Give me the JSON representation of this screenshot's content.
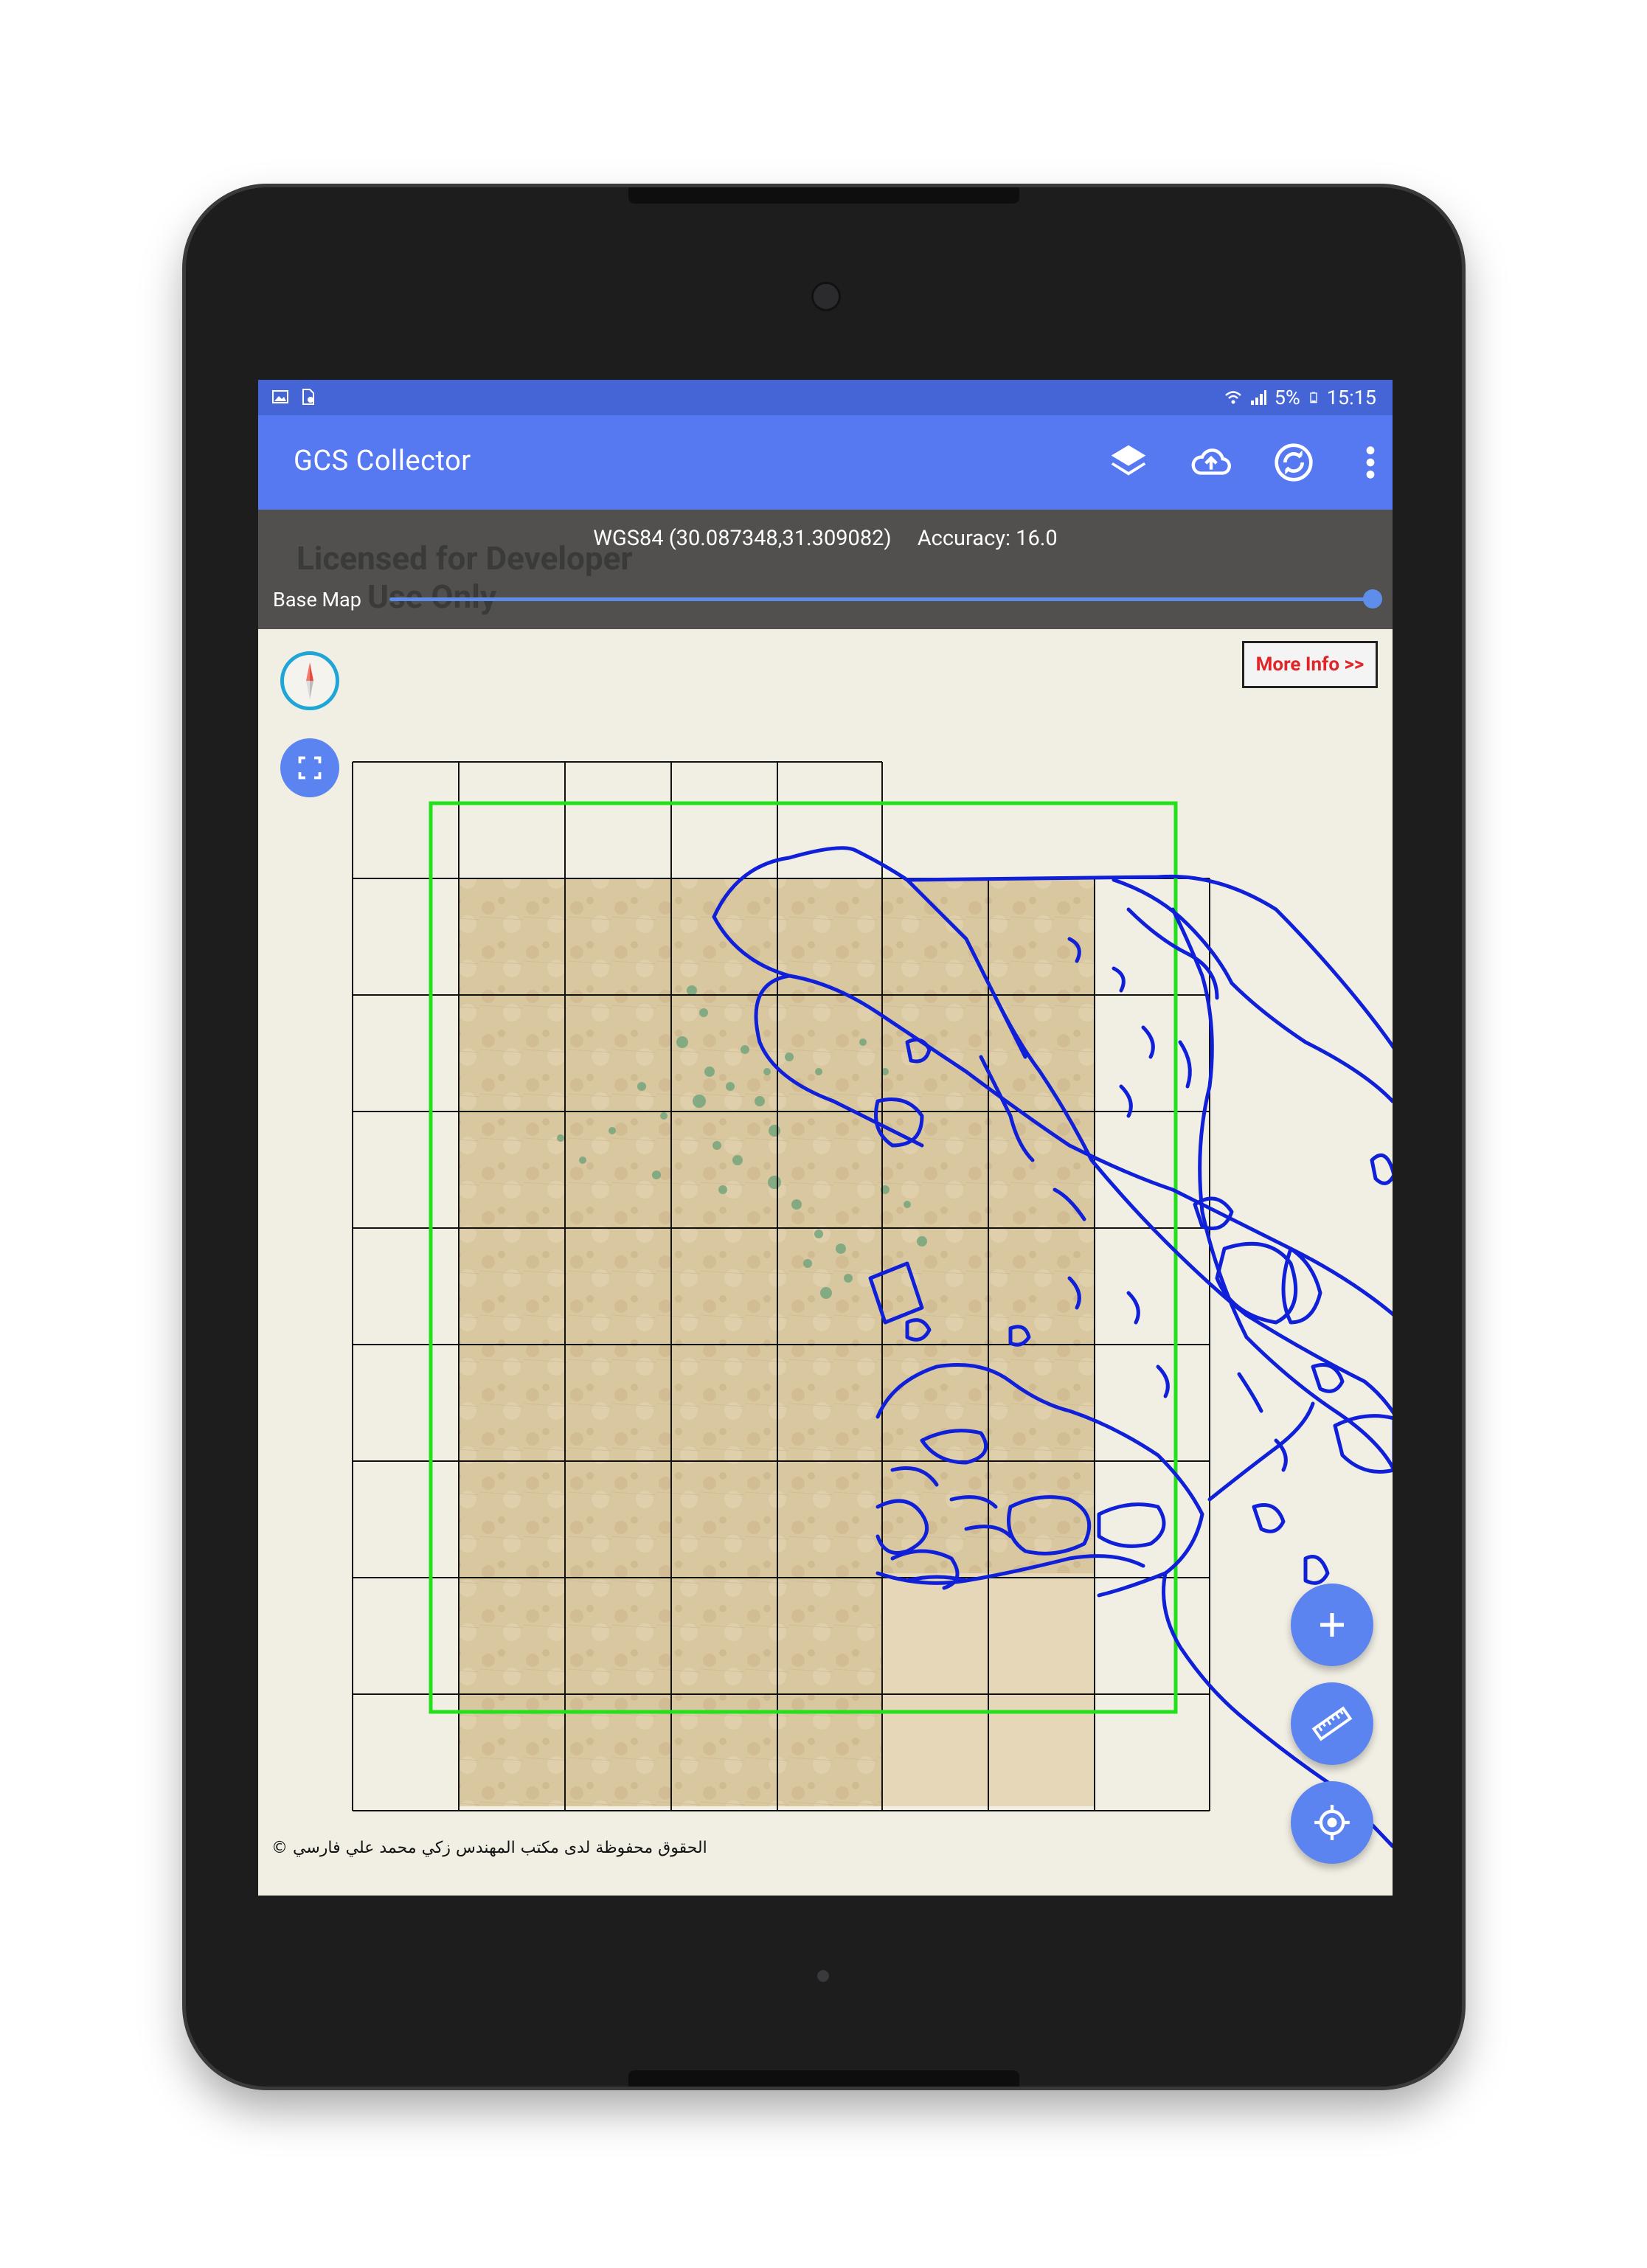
{
  "status_bar": {
    "left_icons": [
      "gallery-icon",
      "document-settings-icon"
    ],
    "battery_text": "5%",
    "time": "15:15",
    "right_icons": [
      "wifi-icon",
      "signal-icon",
      "battery-icon"
    ]
  },
  "app_bar": {
    "title": "GCS Collector",
    "actions": [
      {
        "name": "layers-icon"
      },
      {
        "name": "cloud-upload-icon"
      },
      {
        "name": "sync-icon"
      },
      {
        "name": "more-vert-icon"
      }
    ]
  },
  "gps": {
    "coords": "WGS84 (30.087348,31.309082)",
    "accuracy": "Accuracy: 16.0",
    "basemap_label": "Base Map",
    "basemap_opacity": 1.0
  },
  "watermark": {
    "line1": "Licensed for Developer",
    "line2": "Use Only"
  },
  "map": {
    "more_info": "More Info >>",
    "copyright": "© الحقوق محفوظة لدى مكتب المهندس زكي محمد علي فارسي",
    "grid_color": "#111111",
    "extent_color": "#22e01a",
    "feature_color": "#1020d8",
    "controls": [
      {
        "name": "compass-icon"
      },
      {
        "name": "full-extent-icon"
      },
      {
        "name": "add-icon"
      },
      {
        "name": "measure-ruler-icon"
      },
      {
        "name": "my-location-icon"
      }
    ]
  }
}
